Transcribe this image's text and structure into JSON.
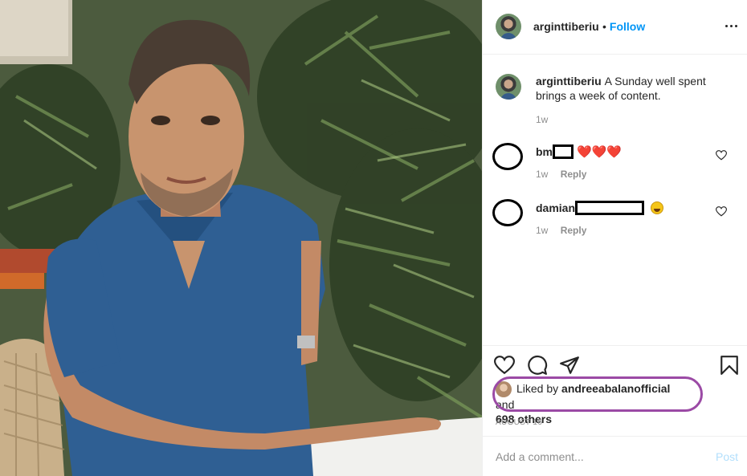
{
  "post": {
    "author": "arginttiberiu",
    "follow_separator": "•",
    "follow_label": "Follow",
    "caption_text": "A Sunday well spent brings a week of content.",
    "caption_time": "1w"
  },
  "comments": [
    {
      "name": "bm",
      "emoji": "❤️❤️❤️",
      "time": "1w",
      "reply_label": "Reply"
    },
    {
      "name": "damian",
      "emoji": "😀",
      "time": "1w",
      "reply_label": "Reply"
    }
  ],
  "likes": {
    "prefix": "Liked by",
    "user": "andreeabalanofficial",
    "joiner": "and",
    "others": "698 others"
  },
  "date": "AUGUST 16",
  "comment_box": {
    "placeholder": "Add a comment...",
    "post_label": "Post"
  },
  "icons": [
    "more-icon",
    "heart-icon",
    "comment-icon",
    "share-icon",
    "bookmark-icon",
    "like-comment-icon"
  ],
  "colors": {
    "link": "#0095f6",
    "post_disabled": "#b2dffc",
    "highlight": "#9b4aa5",
    "muted": "#8e8e8e"
  }
}
